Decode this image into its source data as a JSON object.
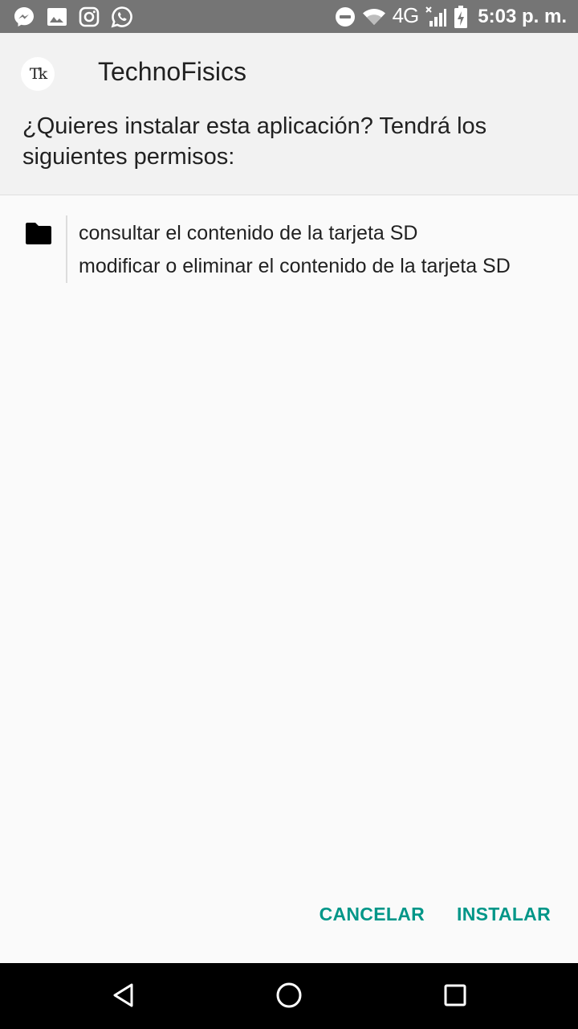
{
  "status_bar": {
    "network": "4G",
    "time": "5:03 p. m.",
    "left_icons": [
      "messenger-icon",
      "gallery-icon",
      "instagram-icon",
      "whatsapp-icon"
    ],
    "right_icons": [
      "do-not-disturb-icon",
      "wifi-icon",
      "signal-icon",
      "battery-charging-icon"
    ]
  },
  "app": {
    "name": "TechnoFisics",
    "icon_text": "Tk"
  },
  "dialog": {
    "prompt": "¿Quieres instalar esta aplicación? Tendrá los siguientes permisos:",
    "permission_group_icon": "folder-icon",
    "permissions": [
      "consultar el contenido de la tarjeta SD",
      "modificar o eliminar el contenido de la tarjeta SD"
    ]
  },
  "actions": {
    "cancel_label": "CANCELAR",
    "install_label": "INSTALAR"
  },
  "nav": {
    "icons": [
      "back-icon",
      "home-icon",
      "recents-icon"
    ]
  },
  "colors": {
    "accent": "#009688",
    "status_bar": "#757575",
    "header_bg": "#f2f2f2",
    "page_bg": "#fafafa",
    "nav_bar": "#000000"
  }
}
